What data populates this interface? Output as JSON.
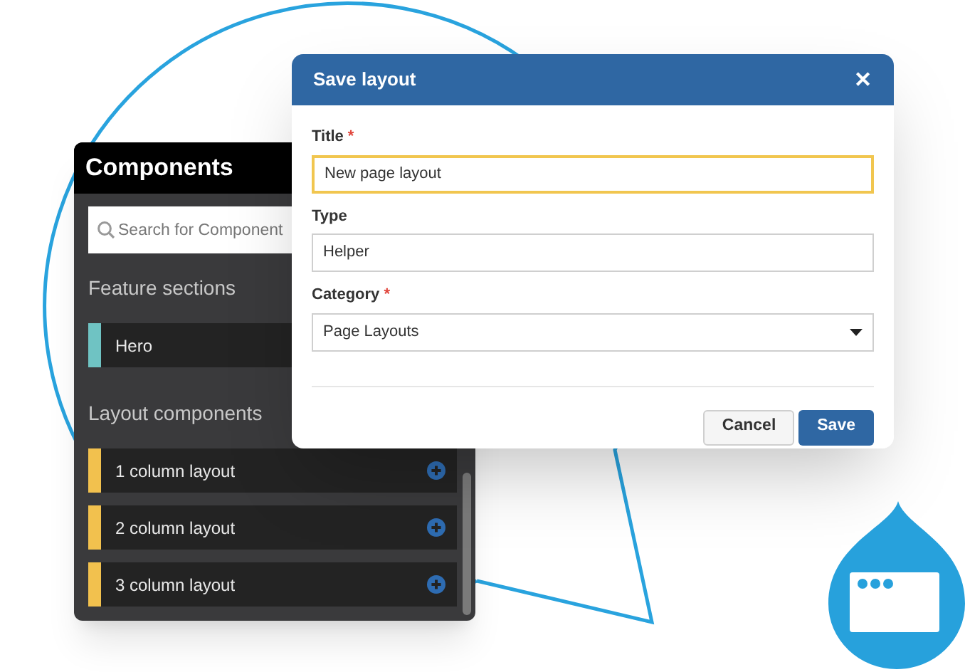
{
  "components_panel": {
    "title": "Components",
    "search": {
      "placeholder": "Search for Component"
    },
    "sections": [
      {
        "heading": "Feature sections",
        "items": [
          {
            "label": "Hero",
            "color": "#6fc3c3"
          }
        ]
      },
      {
        "heading": "Layout components",
        "items": [
          {
            "label": "1 column layout",
            "color": "#f2c14e",
            "add_icon": true
          },
          {
            "label": "2 column layout",
            "color": "#f2c14e",
            "add_icon": true
          },
          {
            "label": "3 column layout",
            "color": "#f2c14e",
            "add_icon": true
          }
        ]
      }
    ]
  },
  "dialog": {
    "title": "Save layout",
    "close": "✕",
    "fields": [
      {
        "label": "Title",
        "required_mark": "*",
        "kind": "text",
        "value": "New page layout",
        "focused": true
      },
      {
        "label": "Type",
        "kind": "text",
        "value": "Helper",
        "focused": false
      },
      {
        "label": "Category",
        "required_mark": "*",
        "kind": "select",
        "value": "Page Layouts",
        "focused": false
      }
    ],
    "buttons": [
      {
        "label": "Cancel",
        "kind": "secondary"
      },
      {
        "label": "Save",
        "kind": "primary"
      }
    ]
  }
}
